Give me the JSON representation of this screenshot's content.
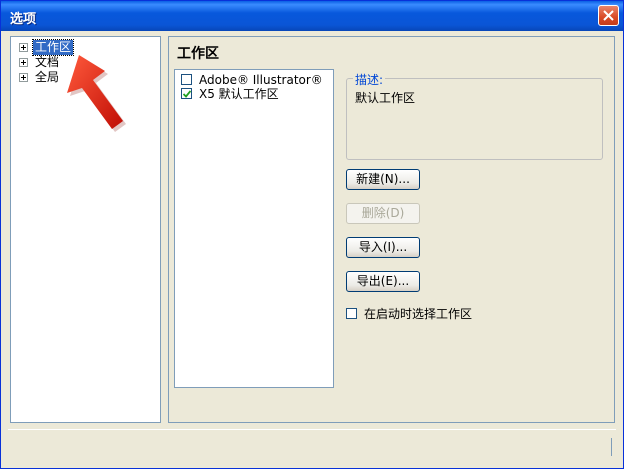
{
  "window": {
    "title": "选项"
  },
  "tree": {
    "items": [
      {
        "label": "工作区",
        "selected": true
      },
      {
        "label": "文档",
        "selected": false
      },
      {
        "label": "全局",
        "selected": false
      }
    ]
  },
  "panel": {
    "title": "工作区",
    "workspaces": [
      {
        "label": "Adobe® Illustrator®",
        "checked": false
      },
      {
        "label": "X5 默认工作区",
        "checked": true
      }
    ],
    "description": {
      "legend": "描述:",
      "text": "默认工作区"
    },
    "buttons": {
      "new": "新建(N)...",
      "delete": "删除(D)",
      "import": "导入(I)...",
      "export": "导出(E)..."
    },
    "startup_checkbox": {
      "label": "在启动时选择工作区",
      "checked": false
    }
  },
  "colors": {
    "titlebar": "#0a5fe4",
    "selection": "#316ac5",
    "arrow": "#e8241a",
    "legend": "#0046d5"
  },
  "icons": [
    "close-icon",
    "plus-icon",
    "checkmark-icon",
    "red-arrow-icon"
  ]
}
